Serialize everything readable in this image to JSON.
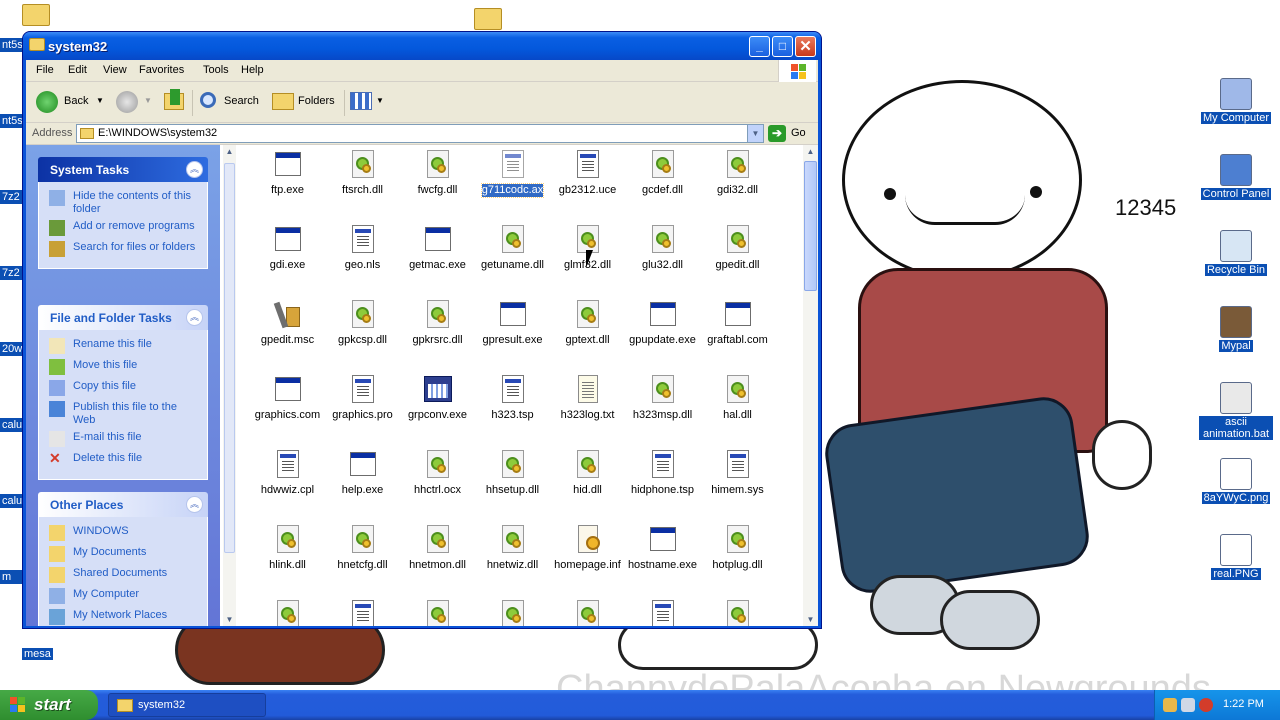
{
  "window": {
    "title": "system32",
    "minimize_label": "_",
    "maximize_label": "□",
    "close_label": "✕"
  },
  "menu": [
    "File",
    "Edit",
    "View",
    "Favorites",
    "Tools",
    "Help"
  ],
  "toolbar": {
    "back_label": "Back",
    "search_label": "Search",
    "folders_label": "Folders"
  },
  "address": {
    "label": "Address",
    "value": "E:\\WINDOWS\\system32",
    "go_label": "Go"
  },
  "taskpane": {
    "system_tasks": {
      "title": "System Tasks",
      "items": [
        "Hide the contents of this folder",
        "Add or remove programs",
        "Search for files or folders"
      ]
    },
    "file_folder_tasks": {
      "title": "File and Folder Tasks",
      "items": [
        "Rename this file",
        "Move this file",
        "Copy this file",
        "Publish this file to the Web",
        "E-mail this file",
        "Delete this file"
      ]
    },
    "other_places": {
      "title": "Other Places",
      "items": [
        "WINDOWS",
        "My Documents",
        "Shared Documents",
        "My Computer",
        "My Network Places"
      ]
    }
  },
  "files": [
    {
      "name": "ftp.exe",
      "icon": "window-app"
    },
    {
      "name": "ftsrch.dll",
      "icon": "dll-gear"
    },
    {
      "name": "fwcfg.dll",
      "icon": "dll-gear"
    },
    {
      "name": "g711codc.ax",
      "icon": "system-file",
      "selected": true
    },
    {
      "name": "gb2312.uce",
      "icon": "system-file"
    },
    {
      "name": "gcdef.dll",
      "icon": "dll-gear"
    },
    {
      "name": "gdi32.dll",
      "icon": "dll-gear"
    },
    {
      "name": "gdi.exe",
      "icon": "window-app"
    },
    {
      "name": "geo.nls",
      "icon": "system-file"
    },
    {
      "name": "getmac.exe",
      "icon": "window-app"
    },
    {
      "name": "getuname.dll",
      "icon": "dll-gear"
    },
    {
      "name": "glmf32.dll",
      "icon": "dll-gear"
    },
    {
      "name": "glu32.dll",
      "icon": "dll-gear"
    },
    {
      "name": "gpedit.dll",
      "icon": "dll-gear"
    },
    {
      "name": "gpedit.msc",
      "icon": "tool"
    },
    {
      "name": "gpkcsp.dll",
      "icon": "dll-gear"
    },
    {
      "name": "gpkrsrc.dll",
      "icon": "dll-gear"
    },
    {
      "name": "gpresult.exe",
      "icon": "window-app"
    },
    {
      "name": "gptext.dll",
      "icon": "dll-gear"
    },
    {
      "name": "gpupdate.exe",
      "icon": "window-app"
    },
    {
      "name": "graftabl.com",
      "icon": "window-app"
    },
    {
      "name": "graphics.com",
      "icon": "window-app"
    },
    {
      "name": "graphics.pro",
      "icon": "system-file"
    },
    {
      "name": "grpconv.exe",
      "icon": "app"
    },
    {
      "name": "h323.tsp",
      "icon": "system-file"
    },
    {
      "name": "h323log.txt",
      "icon": "text"
    },
    {
      "name": "h323msp.dll",
      "icon": "dll-gear"
    },
    {
      "name": "hal.dll",
      "icon": "dll-gear"
    },
    {
      "name": "hdwwiz.cpl",
      "icon": "system-file"
    },
    {
      "name": "help.exe",
      "icon": "window-app"
    },
    {
      "name": "hhctrl.ocx",
      "icon": "dll-gear"
    },
    {
      "name": "hhsetup.dll",
      "icon": "dll-gear"
    },
    {
      "name": "hid.dll",
      "icon": "dll-gear"
    },
    {
      "name": "hidphone.tsp",
      "icon": "system-file"
    },
    {
      "name": "himem.sys",
      "icon": "system-file"
    },
    {
      "name": "hlink.dll",
      "icon": "dll-gear"
    },
    {
      "name": "hnetcfg.dll",
      "icon": "dll-gear"
    },
    {
      "name": "hnetmon.dll",
      "icon": "dll-gear"
    },
    {
      "name": "hnetwiz.dll",
      "icon": "dll-gear"
    },
    {
      "name": "homepage.inf",
      "icon": "inf"
    },
    {
      "name": "hostname.exe",
      "icon": "window-app"
    },
    {
      "name": "hotplug.dll",
      "icon": "dll-gear"
    },
    {
      "name": "",
      "icon": "dll-gear"
    },
    {
      "name": "",
      "icon": "system-file"
    },
    {
      "name": "",
      "icon": "dll-gear"
    },
    {
      "name": "",
      "icon": "dll-gear"
    },
    {
      "name": "",
      "icon": "dll-gear"
    },
    {
      "name": "",
      "icon": "system-file"
    },
    {
      "name": "",
      "icon": "dll-gear"
    }
  ],
  "desktop": {
    "icons": [
      {
        "label": "My Computer",
        "icon": "my-computer-icon"
      },
      {
        "label": "Control Panel",
        "icon": "control-panel-icon"
      },
      {
        "label": "Recycle Bin",
        "icon": "recycle-bin-icon"
      },
      {
        "label": "Mypal",
        "icon": "mypal-icon"
      },
      {
        "label": "ascii animation.bat",
        "icon": "batch-file-icon"
      },
      {
        "label": "8aYWyC.png",
        "icon": "image-file-icon"
      },
      {
        "label": "real.PNG",
        "icon": "image-file-icon"
      }
    ],
    "left_clipped_labels": [
      "nt5s",
      "nt5s",
      "7z2",
      "7z2",
      "20w",
      "calu",
      "calu",
      "m"
    ],
    "mesa_label": "mesa",
    "wallpaper_caption": "12345",
    "wallpaper_signature": "ChannydePalaAcopha en Newgrounds"
  },
  "taskbar": {
    "start_label": "start",
    "task_label": "system32",
    "clock": "1:22 PM"
  }
}
